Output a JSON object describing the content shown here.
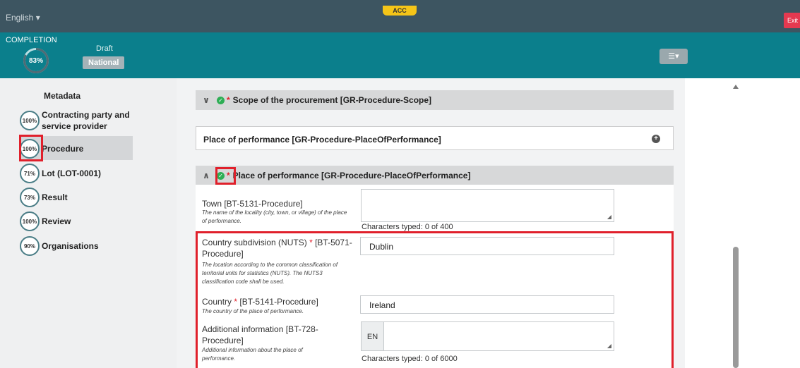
{
  "topbar": {
    "language": "English",
    "env_badge": "ACC",
    "exit_label": "Exit"
  },
  "header": {
    "completion_label": "COMPLETION",
    "completion_percent": "83%",
    "completion_value": 0.83,
    "status": "Draft",
    "scope": "National"
  },
  "sidebar": {
    "title": "Metadata",
    "items": [
      {
        "percent": "100%",
        "label_line1": "Contracting party and",
        "label_line2": "service provider"
      },
      {
        "percent": "100%",
        "label": "Procedure"
      },
      {
        "percent": "71%",
        "label": "Lot (LOT-0001)"
      },
      {
        "percent": "73%",
        "label": "Result"
      },
      {
        "percent": "100%",
        "label": "Review"
      },
      {
        "percent": "90%",
        "label": "Organisations"
      }
    ]
  },
  "main": {
    "scope_header": "Scope of the procurement  [GR-Procedure-Scope]",
    "place_header": "Place of performance  [GR-Procedure-PlaceOfPerformance]",
    "place_expanded_header": "Place of performance  [GR-Procedure-PlaceOfPerformance]",
    "required_mark": "*",
    "town": {
      "label": "Town [BT-5131-Procedure]",
      "description": "The name of the locality (city, town, or village) of the place of performance.",
      "value": "",
      "chars": "Characters typed: 0 of 400"
    },
    "nuts": {
      "label_line1": "Country subdivision (NUTS)",
      "label_code1": "[BT-5071-",
      "label_line2": "Procedure]",
      "description": "The location according to the common classification of territorial units for statistics (NUTS). The NUTS3 classification code shall be used.",
      "value": "Dublin"
    },
    "country": {
      "label": "Country",
      "label_code": "[BT-5141-Procedure]",
      "description": "The country of the place of performance.",
      "value": "Ireland"
    },
    "additional": {
      "label_line1": "Additional information [BT-728-",
      "label_line2": "Procedure]",
      "description": "Additional information about the place of performance.",
      "lang": "EN",
      "value": "",
      "chars": "Characters typed: 0 of 6000"
    }
  },
  "colors": {
    "topbar": "#3d5561",
    "header": "#0b7f8c",
    "highlight": "#e0202b",
    "check": "#2eae55"
  }
}
